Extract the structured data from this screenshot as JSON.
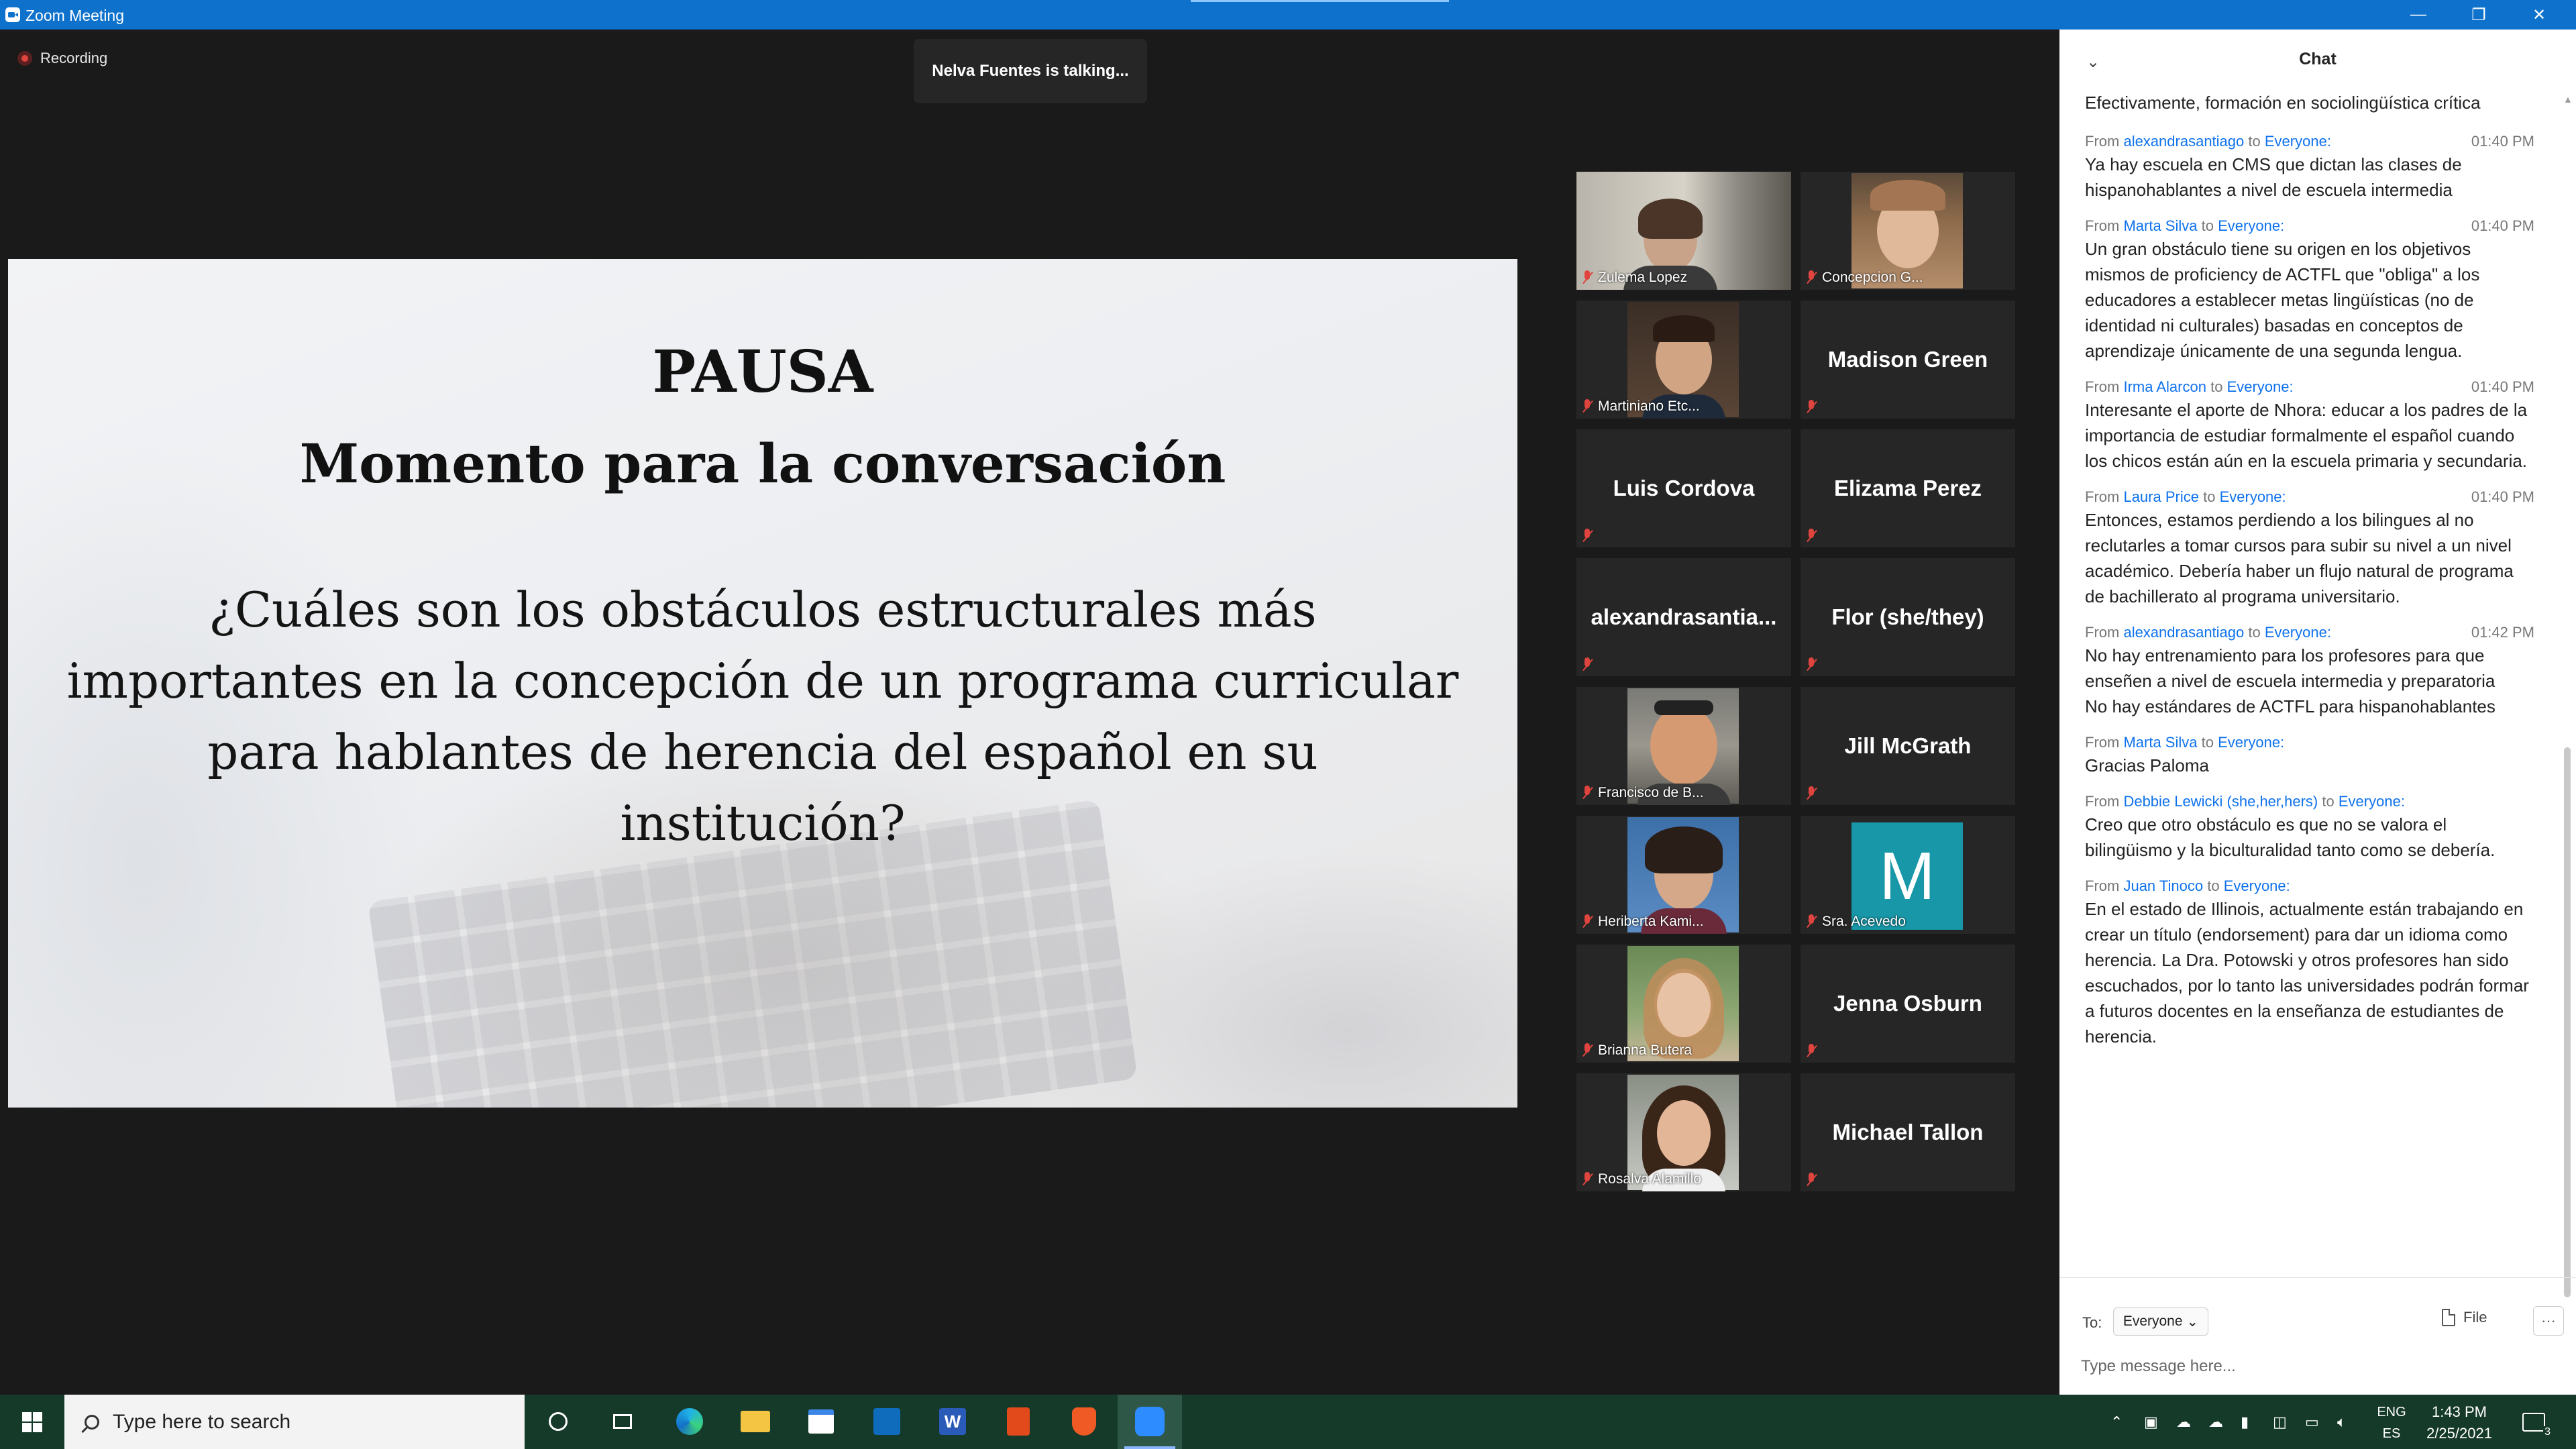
{
  "window": {
    "title": "Zoom Meeting",
    "minimize": "—",
    "restore": "❐",
    "close": "✕"
  },
  "meeting": {
    "recording_label": "Recording",
    "talking_indicator": "Nelva Fuentes is talking..."
  },
  "slide": {
    "title": "PAUSA",
    "subtitle": "Momento para la conversación",
    "question": "¿Cuáles son los obstáculos estructurales más importantes en la concepción de un programa curricular para hablantes de herencia del español en su institución?"
  },
  "participants": [
    {
      "name": "Zulema Lopez",
      "display": "video"
    },
    {
      "name": "Concepcion G...",
      "display": "photo"
    },
    {
      "name": "Martiniano Etc...",
      "display": "photo"
    },
    {
      "name": "Madison Green",
      "display": "name"
    },
    {
      "name": "Luis Cordova",
      "display": "name"
    },
    {
      "name": "Elizama Perez",
      "display": "name"
    },
    {
      "name": "alexandrasantia...",
      "display": "name"
    },
    {
      "name": "Flor (she/they)",
      "display": "name"
    },
    {
      "name": "Francisco de B...",
      "display": "photo"
    },
    {
      "name": "Jill McGrath",
      "display": "name"
    },
    {
      "name": "Heriberta Kami...",
      "display": "photo"
    },
    {
      "name": "Sra. Acevedo",
      "display": "avatar",
      "initial": "M"
    },
    {
      "name": "Brianna Butera",
      "display": "photo"
    },
    {
      "name": "Jenna Osburn",
      "display": "name"
    },
    {
      "name": "Rosalva Alamillo",
      "display": "photo"
    },
    {
      "name": "Michael Tallon",
      "display": "name"
    }
  ],
  "chat": {
    "title": "Chat",
    "first_line": "Efectivamente, formación en sociolingüística crítica",
    "messages": [
      {
        "from": "alexandrasantiago",
        "to": "Everyone:",
        "time": "01:40 PM",
        "text": "Ya hay escuela en CMS que dictan las clases de hispanohablantes a nivel de escuela intermedia"
      },
      {
        "from": "Marta Silva",
        "to": "Everyone:",
        "time": "01:40 PM",
        "text": "Un gran obstáculo tiene su origen en los objetivos mismos de proficiency de ACTFL que \"obliga\" a los educadores a establecer metas lingüísticas (no de identidad ni culturales) basadas en conceptos de aprendizaje únicamente de una segunda lengua."
      },
      {
        "from": "Irma Alarcon",
        "to": "Everyone:",
        "time": "01:40 PM",
        "text": "Interesante el aporte de Nhora: educar a los padres de la importancia de estudiar formalmente el español cuando los chicos están aún en la escuela primaria y secundaria."
      },
      {
        "from": "Laura Price",
        "to": "Everyone:",
        "time": "01:40 PM",
        "text": "Entonces, estamos perdiendo a los bilingues al no reclutarles a tomar cursos para subir su nivel a un nivel académico.  Debería haber un flujo natural de programa de bachillerato al programa universitario."
      },
      {
        "from": "alexandrasantiago",
        "to": "Everyone:",
        "time": "01:42 PM",
        "text": "No hay entrenamiento para los profesores para que enseñen a nivel de escuela intermedia y preparatoria\nNo hay estándares de ACTFL para hispanohablantes"
      },
      {
        "from": "Marta Silva",
        "to": "Everyone:",
        "time": "",
        "text": "Gracias Paloma"
      },
      {
        "from": "Debbie Lewicki (she,her,hers)",
        "to": "Everyone:",
        "time": "",
        "text": "Creo que otro obstáculo es que no se valora el bilingüismo y la biculturalidad tanto como se debería."
      },
      {
        "from": "Juan Tinoco",
        "to": "Everyone:",
        "time": "",
        "text": "En el estado de Illinois, actualmente están trabajando en crear un título (endorsement) para dar un idioma como herencia. La Dra. Potowski y otros profesores han sido escuchados, por lo tanto las universidades podrán formar a futuros docentes en la enseñanza de estudiantes de herencia."
      }
    ],
    "from_prefix": "From",
    "to_word": "to",
    "to_label": "To:",
    "recipient": "Everyone",
    "file_label": "File",
    "more_label": "···",
    "input_placeholder": "Type message here..."
  },
  "taskbar": {
    "search_placeholder": "Type here to search",
    "lang_top": "ENG",
    "lang_bottom": "ES",
    "time": "1:43 PM",
    "date": "2/25/2021",
    "notification_count": "3"
  },
  "colors": {
    "titlebar": "#0e72cc",
    "chat_link": "#0e72ed",
    "muted_mic": "#e0443e",
    "taskbar": "#163a2a"
  }
}
